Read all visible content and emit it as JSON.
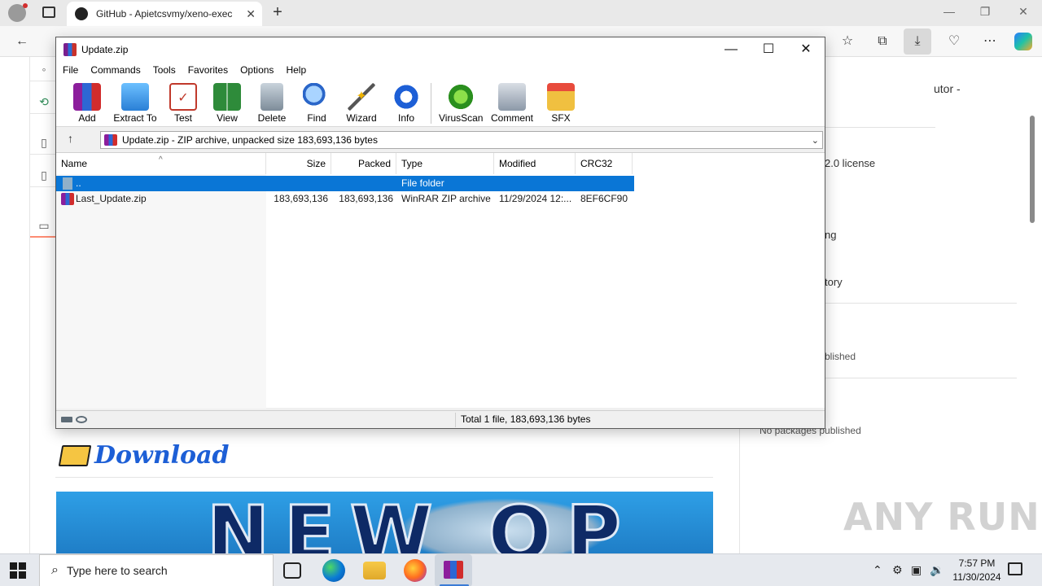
{
  "browser": {
    "tab_title": "GitHub - Apietcsvmy/xeno-exec",
    "tab_close": "✕",
    "new_tab": "+"
  },
  "webpage": {
    "right_panel": {
      "text_1": "utor -",
      "license": "2.0 license",
      "text_ng": "ng",
      "text_tory": "tory",
      "text_published": "blished",
      "no_packages": "No packages published"
    },
    "download_heading": "Download",
    "banner_text": "NEW OP",
    "watermark": "ANY RUN"
  },
  "winrar": {
    "title": "Update.zip",
    "menu": [
      "File",
      "Commands",
      "Tools",
      "Favorites",
      "Options",
      "Help"
    ],
    "toolbar": [
      "Add",
      "Extract To",
      "Test",
      "View",
      "Delete",
      "Find",
      "Wizard",
      "Info",
      "VirusScan",
      "Comment",
      "SFX"
    ],
    "path": "Update.zip - ZIP archive, unpacked size 183,693,136 bytes",
    "columns": {
      "name": "Name",
      "size": "Size",
      "packed": "Packed",
      "type": "Type",
      "modified": "Modified",
      "crc": "CRC32"
    },
    "rows": [
      {
        "name": "..",
        "size": "",
        "packed": "",
        "type": "File folder",
        "modified": "",
        "crc": ""
      },
      {
        "name": "Last_Update.zip",
        "size": "183,693,136",
        "packed": "183,693,136",
        "type": "WinRAR ZIP archive",
        "modified": "11/29/2024 12:...",
        "crc": "8EF6CF90"
      }
    ],
    "status": "Total 1 file, 183,693,136 bytes"
  },
  "taskbar": {
    "search_placeholder": "Type here to search",
    "time": "7:57 PM",
    "date": "11/30/2024"
  },
  "colors": {
    "selection": "#0a76d6",
    "download_heading": "#1d5fd6",
    "banner": "#2e9fe6"
  }
}
